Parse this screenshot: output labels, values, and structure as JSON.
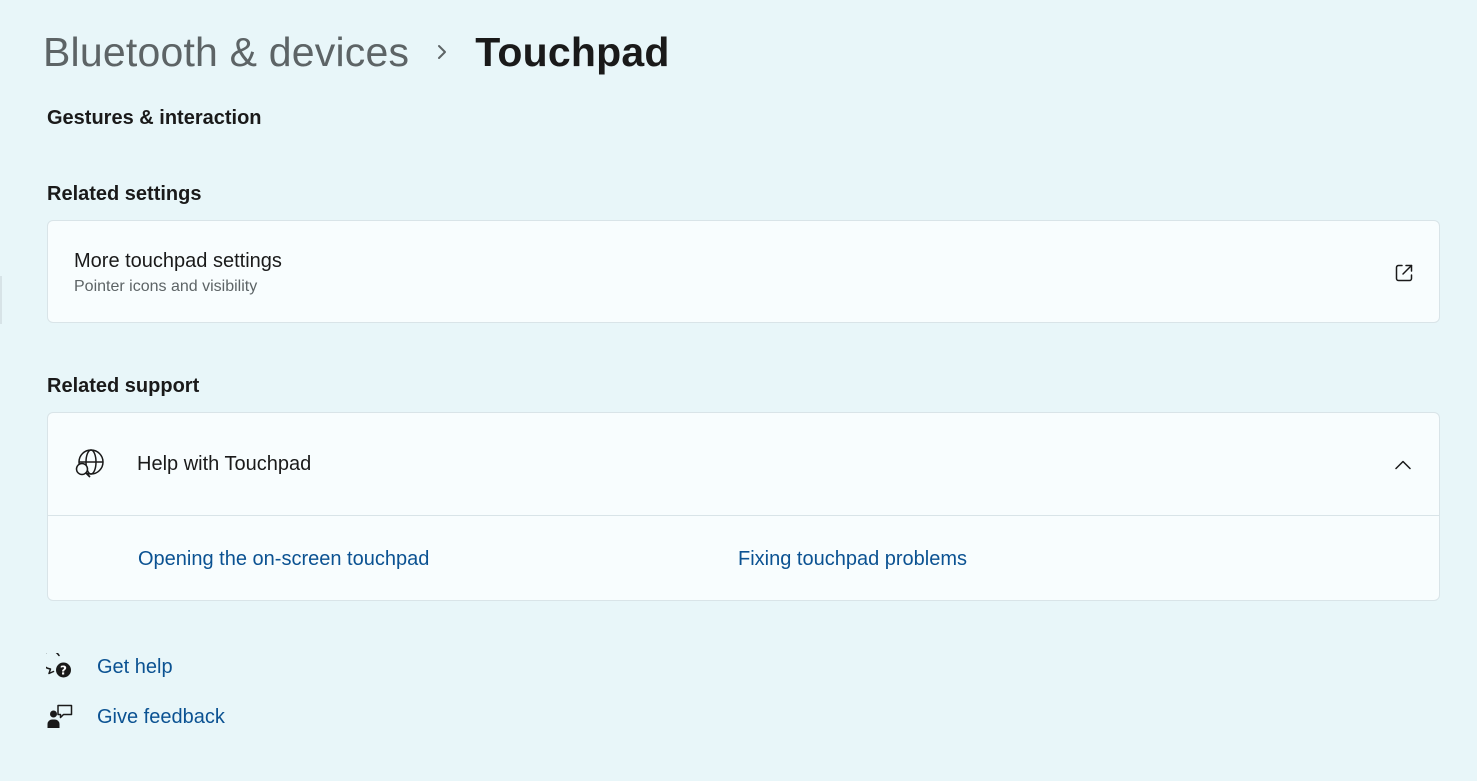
{
  "breadcrumb": {
    "parent": "Bluetooth & devices",
    "separator_icon": "chevron-right-icon",
    "current": "Touchpad"
  },
  "sections": {
    "gestures": "Gestures & interaction",
    "related_settings": "Related settings",
    "related_support": "Related support"
  },
  "touchpad_settings": {
    "title": "More touchpad settings",
    "subtitle": "Pointer icons and visibility",
    "icon": "external-link-icon"
  },
  "help": {
    "title": "Help with Touchpad",
    "icon": "globe-search-icon",
    "expand_icon": "chevron-up-icon",
    "links": [
      "Opening the on-screen touchpad",
      "Fixing touchpad problems"
    ]
  },
  "footer": {
    "get_help": "Get help",
    "get_help_icon": "help-chat-icon",
    "give_feedback": "Give feedback",
    "give_feedback_icon": "feedback-icon"
  },
  "colors": {
    "background": "#e8f6f9",
    "card": "#f8fdfe",
    "link": "#0b5292",
    "text": "#1a1a1a",
    "secondary_text": "#5d6466"
  }
}
